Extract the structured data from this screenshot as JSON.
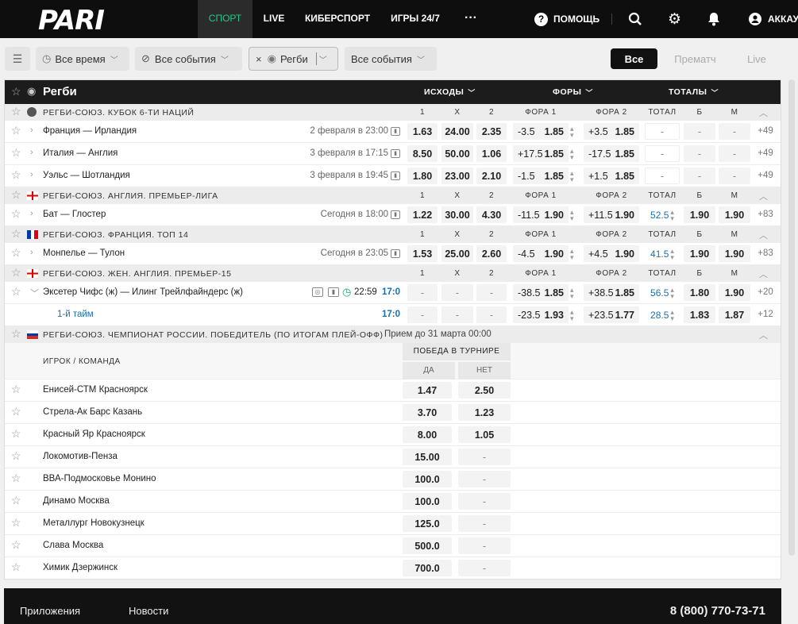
{
  "brand": "PARI",
  "nav": [
    "СПОРТ",
    "LIVE",
    "КИБЕРСПОРТ",
    "ИГРЫ 24/7",
    "···"
  ],
  "top_right": {
    "help": "ПОМОЩЬ",
    "account": "АККАУ"
  },
  "filters": {
    "time": "Все время",
    "events": "Все события",
    "sport": "Регби",
    "events2": "Все события"
  },
  "segments": [
    "Все",
    "Прематч",
    "Live"
  ],
  "sport_title": "Регби",
  "col_groups": {
    "out": "ИСХОДЫ",
    "fora": "ФОРЫ",
    "tot": "ТОТАЛЫ"
  },
  "col_labels": {
    "c1": "1",
    "cx": "X",
    "c2": "2",
    "f1": "ФОРА 1",
    "f2": "ФОРА 2",
    "total": "ТОТАЛ",
    "b": "Б",
    "m": "М"
  },
  "leagues": [
    {
      "name": "РЕГБИ-СОЮЗ. КУБОК 6-ТИ НАЦИЙ",
      "flag": "cup-icon",
      "matches": [
        {
          "teams": "Франция — Ирландия",
          "time": "2 февраля в 23:00",
          "o1": "1.63",
          "ox": "24.00",
          "o2": "2.35",
          "f1h": "-3.5",
          "f1o": "1.85",
          "f2h": "+3.5",
          "f2o": "1.85",
          "tot": "-",
          "b": "-",
          "m": "-",
          "more": "+49"
        },
        {
          "teams": "Италия — Англия",
          "time": "3 февраля в 17:15",
          "o1": "8.50",
          "ox": "50.00",
          "o2": "1.06",
          "f1h": "+17.5",
          "f1o": "1.85",
          "f2h": "-17.5",
          "f2o": "1.85",
          "tot": "-",
          "b": "-",
          "m": "-",
          "more": "+49"
        },
        {
          "teams": "Уэльс — Шотландия",
          "time": "3 февраля в 19:45",
          "o1": "1.80",
          "ox": "23.00",
          "o2": "2.10",
          "f1h": "-1.5",
          "f1o": "1.85",
          "f2h": "+1.5",
          "f2o": "1.85",
          "tot": "-",
          "b": "-",
          "m": "-",
          "more": "+49"
        }
      ]
    },
    {
      "name": "РЕГБИ-СОЮЗ. АНГЛИЯ. ПРЕМЬЕР-ЛИГА",
      "flag": "england-flag-icon",
      "matches": [
        {
          "teams": "Бат — Глостер",
          "time": "Сегодня в 18:00",
          "o1": "1.22",
          "ox": "30.00",
          "o2": "4.30",
          "f1h": "-11.5",
          "f1o": "1.90",
          "f2h": "+11.5",
          "f2o": "1.90",
          "tot": "52.5",
          "b": "1.90",
          "m": "1.90",
          "more": "+83"
        }
      ]
    },
    {
      "name": "РЕГБИ-СОЮЗ. ФРАНЦИЯ. ТОП 14",
      "flag": "france-flag-icon",
      "matches": [
        {
          "teams": "Монпелье — Тулон",
          "time": "Сегодня в 23:05",
          "o1": "1.53",
          "ox": "25.00",
          "o2": "2.60",
          "f1h": "-4.5",
          "f1o": "1.90",
          "f2h": "+4.5",
          "f2o": "1.90",
          "tot": "41.5",
          "b": "1.90",
          "m": "1.90",
          "more": "+83"
        }
      ]
    },
    {
      "name": "РЕГБИ-СОЮЗ. ЖЕН. АНГЛИЯ. ПРЕМЬЕР-15",
      "flag": "england-flag-icon",
      "matches": [
        {
          "teams": "Эксетер Чифс (ж) — Илинг Трейлфайндерс (ж)",
          "time": "22:59",
          "score": "17:0",
          "o1": "-",
          "ox": "-",
          "o2": "-",
          "f1h": "-38.5",
          "f1o": "1.85",
          "f2h": "+38.5",
          "f2o": "1.85",
          "tot": "56.5",
          "b": "1.80",
          "m": "1.90",
          "more": "+20",
          "live": true
        },
        {
          "teams": "1-й тайм",
          "time": "",
          "score": "17:0",
          "o1": "-",
          "ox": "-",
          "o2": "-",
          "f1h": "-23.5",
          "f1o": "1.93",
          "f2h": "+23.5",
          "f2o": "1.77",
          "tot": "28.5",
          "b": "1.83",
          "m": "1.87",
          "more": "+12",
          "sub": true
        }
      ]
    }
  ],
  "winner": {
    "league": "РЕГБИ-СОЮЗ. ЧЕМПИОНАТ РОССИИ. ПОБЕДИТЕЛЬ (ПО ИТОГАМ ПЛЕЙ-ОФФ)",
    "deadline": "Прием до 31 марта 00:00",
    "head": "ИГРОК / КОМАНДА",
    "market": "ПОБЕДА В ТУРНИРЕ",
    "yes": "ДА",
    "no": "НЕТ",
    "rows": [
      [
        "Енисей-СТМ Красноярск",
        "1.47",
        "2.50"
      ],
      [
        "Стрела-Ак Барс Казань",
        "3.70",
        "1.23"
      ],
      [
        "Красный Яр Красноярск",
        "8.00",
        "1.05"
      ],
      [
        "Локомотив-Пенза",
        "15.00",
        "-"
      ],
      [
        "ВВА-Подмосковье Монино",
        "100.0",
        "-"
      ],
      [
        "Динамо Москва",
        "100.0",
        "-"
      ],
      [
        "Металлург Новокузнецк",
        "125.0",
        "-"
      ],
      [
        "Слава Москва",
        "500.0",
        "-"
      ],
      [
        "Химик Дзержинск",
        "700.0",
        "-"
      ]
    ]
  },
  "footer": {
    "apps": "Приложения",
    "news": "Новости",
    "phone": "8 (800) 770-73-71"
  },
  "colors": {
    "accent": "#21c98b",
    "link": "#1a6fa8",
    "header": "#0e0e0e"
  }
}
